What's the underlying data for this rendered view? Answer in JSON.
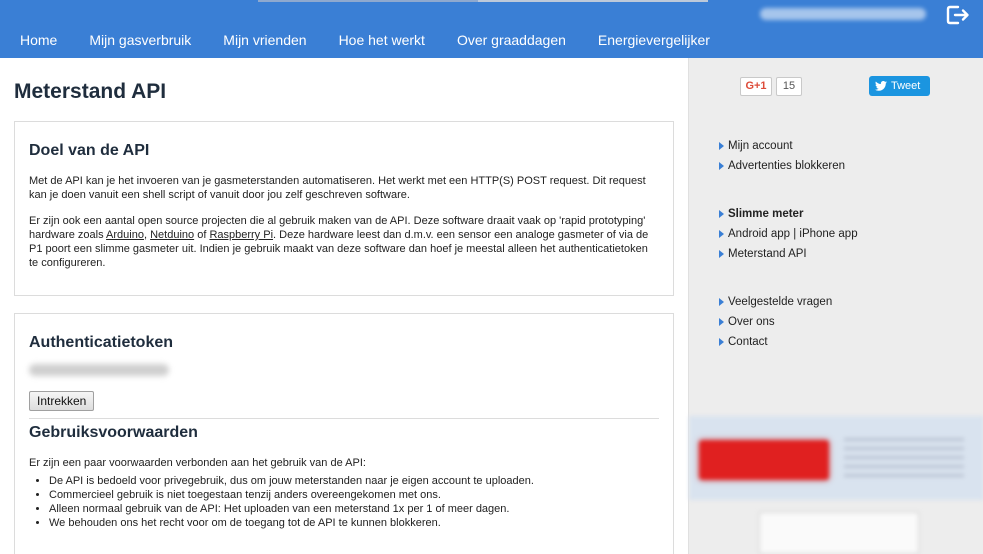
{
  "colors": {
    "brand": "#3a7fd5",
    "accent_tweet": "#1b95e0",
    "gplus": "#dd4b39"
  },
  "header": {
    "nav": [
      "Home",
      "Mijn gasverbruik",
      "Mijn vrienden",
      "Hoe het werkt",
      "Over graaddagen",
      "Energievergelijker"
    ],
    "logout_icon": "logout-icon"
  },
  "main": {
    "title": "Meterstand API",
    "purpose": {
      "heading": "Doel van de API",
      "p1": "Met de API kan je het invoeren van je gasmeterstanden automatiseren. Het werkt met een HTTP(S) POST request. Dit request kan je doen vanuit een shell script of vanuit door jou zelf geschreven software.",
      "p2_a": "Er zijn ook een aantal open source projecten die al gebruik maken van de API. Deze software draait vaak op 'rapid prototyping' hardware zoals ",
      "link_arduino": "Arduino",
      "sep1": ", ",
      "link_netduino": "Netduino",
      "sep2": " of ",
      "link_raspberry": "Raspberry Pi",
      "p2_b": ". Deze hardware leest dan d.m.v. een sensor een analoge gasmeter of via de P1 poort een slimme gasmeter uit. Indien je gebruik maakt van deze software dan hoef je meestal alleen het authenticatietoken te configureren."
    },
    "auth": {
      "heading": "Authenticatietoken",
      "revoke_button": "Intrekken"
    },
    "terms": {
      "heading": "Gebruiksvoorwaarden",
      "intro": "Er zijn een paar voorwaarden verbonden aan het gebruik van de API:",
      "items": [
        "De API is bedoeld voor privegebruik, dus om jouw meterstanden naar je eigen account te uploaden.",
        "Commercieel gebruik is niet toegestaan tenzij anders overeengekomen met ons.",
        "Alleen normaal gebruik van de API: Het uploaden van een meterstand 1x per 1 of meer dagen.",
        "We behouden ons het recht voor om de toegang tot de API te kunnen blokkeren."
      ]
    }
  },
  "sidebar": {
    "gplus_label": "G+1",
    "gplus_count": "15",
    "tweet_label": "Tweet",
    "group1": [
      "Mijn account",
      "Advertenties blokkeren"
    ],
    "group2": [
      "Slimme meter",
      "Android app | iPhone app",
      "Meterstand API"
    ],
    "group3": [
      "Veelgestelde vragen",
      "Over ons",
      "Contact"
    ]
  }
}
